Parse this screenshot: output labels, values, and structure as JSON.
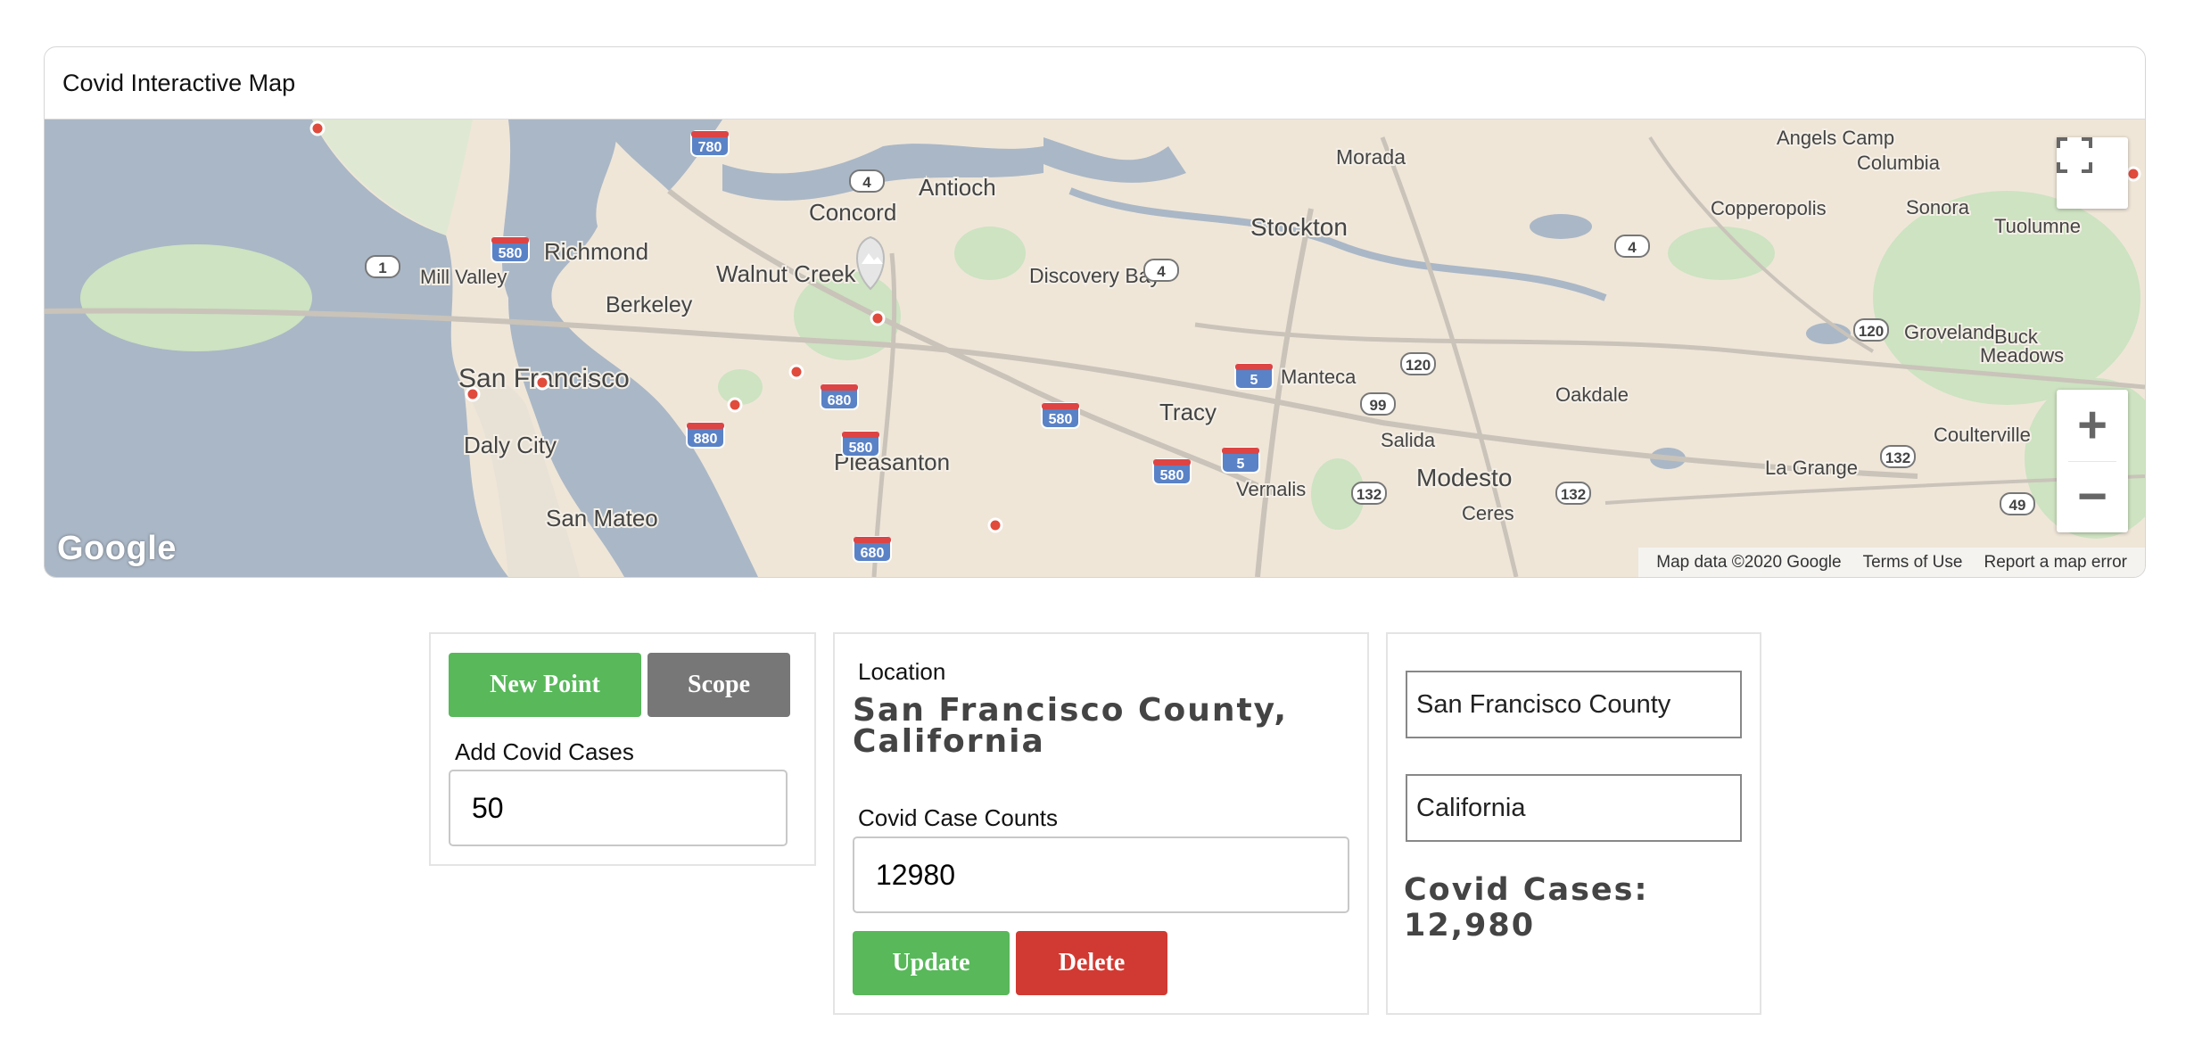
{
  "map_card": {
    "title": "Covid Interactive Map",
    "google_logo": "Google",
    "attribution": [
      "Map data ©2020 Google",
      "Terms of Use",
      "Report a map error"
    ],
    "fullscreen_icon": "fullscreen-icon",
    "zoom_in_label": "+",
    "zoom_out_label": "−",
    "place_labels": [
      "Angels Camp",
      "Columbia",
      "Morada",
      "Sonora",
      "Tuolumne",
      "Copperopolis",
      "Antioch",
      "Concord",
      "Stockton",
      "Richmond",
      "Mill Valley",
      "Walnut Creek",
      "Discovery Bay",
      "Berkeley",
      "Groveland",
      "Buck",
      "Meadows",
      "San Francisco",
      "Manteca",
      "Oakdale",
      "Tracy",
      "Daly City",
      "Salida",
      "Coulterville",
      "Pleasanton",
      "La Grange",
      "Vernalis",
      "Modesto",
      "Ceres",
      "San Mateo"
    ],
    "highway_shields": [
      "780",
      "580",
      "1",
      "4",
      "4",
      "4",
      "680",
      "880",
      "580",
      "580",
      "5",
      "120",
      "99",
      "5",
      "580",
      "132",
      "132",
      "132",
      "120",
      "49",
      "680"
    ],
    "colors": {
      "water": "#aab7c6",
      "land": "#efe6d8",
      "park": "#cde3c1",
      "marker": "#e04b3c",
      "interstate": "#5a82c6"
    }
  },
  "panel_add": {
    "new_point_label": "New Point",
    "scope_label": "Scope",
    "add_cases_label": "Add Covid Cases",
    "add_cases_value": "50"
  },
  "panel_location": {
    "location_label": "Location",
    "location_name": "San Francisco County, California",
    "case_counts_label": "Covid Case Counts",
    "case_counts_value": "12980",
    "update_label": "Update",
    "delete_label": "Delete"
  },
  "panel_summary": {
    "county_value": "San Francisco County",
    "state_value": "California",
    "cases_text": "Covid Cases: 12,980"
  }
}
